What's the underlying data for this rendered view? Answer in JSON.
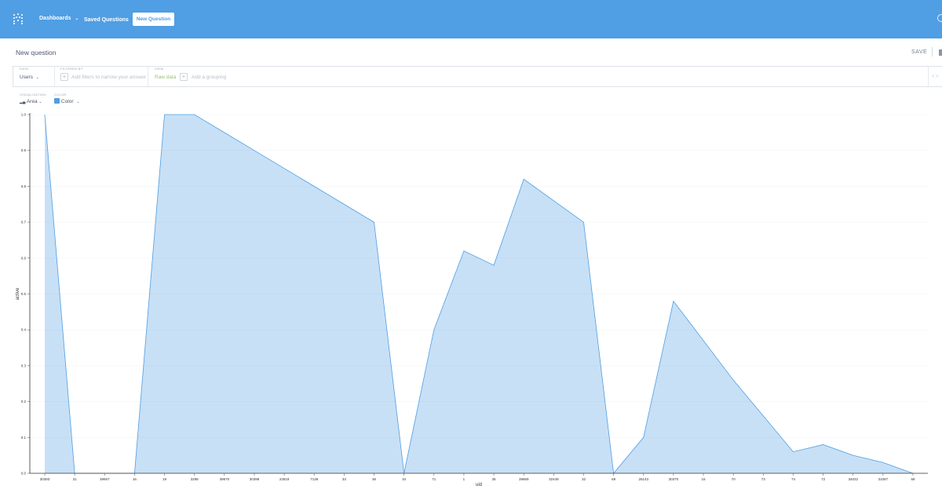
{
  "nav": {
    "dashboards": "Dashboards",
    "saved_questions": "Saved Questions",
    "new_question": "New Question"
  },
  "header": {
    "title": "New question",
    "save": "SAVE"
  },
  "query": {
    "data_label": "DATA",
    "data_value": "Users",
    "filter_label": "FILTERED BY",
    "filter_placeholder": "Add filters to narrow your answer",
    "view_label": "VIEW",
    "view_value": "Raw data",
    "grouping_placeholder": "Add a grouping"
  },
  "visualization": {
    "viz_label": "VISUALIZATION",
    "viz_value": "Area",
    "color_label": "COLOR",
    "color_value": "Color"
  },
  "colors": {
    "brand": "#509ee3",
    "area_fill": "#509ee3",
    "area_stroke": "#509ee3"
  },
  "chart_data": {
    "type": "area",
    "xlabel": "uid",
    "ylabel": "active",
    "ylim": [
      0,
      1.0
    ],
    "y_ticks": [
      "0.0",
      "0.1",
      "0.2",
      "0.3",
      "0.4",
      "0.5",
      "0.6",
      "0.7",
      "0.8",
      "0.9",
      "1.0"
    ],
    "categories": [
      "30393",
      "31",
      "39667",
      "16",
      "19",
      "3288",
      "39670",
      "30398",
      "22819",
      "7136",
      "33",
      "36",
      "34",
      "71",
      "1",
      "35",
      "39869",
      "32449",
      "32",
      "69",
      "25143",
      "30370",
      "15",
      "70",
      "73",
      "74",
      "72",
      "34022",
      "31087",
      "68"
    ],
    "series": [
      {
        "values": [
          1,
          0,
          0,
          0,
          1,
          1,
          0.95,
          0.9,
          0.85,
          0.8,
          0.75,
          0.7,
          0,
          0.4,
          0.62,
          0.58,
          0.82,
          0.76,
          0.7,
          0,
          0.1,
          0.48,
          0.37,
          0.26,
          0.16,
          0.06,
          0.08,
          0.05,
          0.03,
          0
        ]
      }
    ]
  }
}
